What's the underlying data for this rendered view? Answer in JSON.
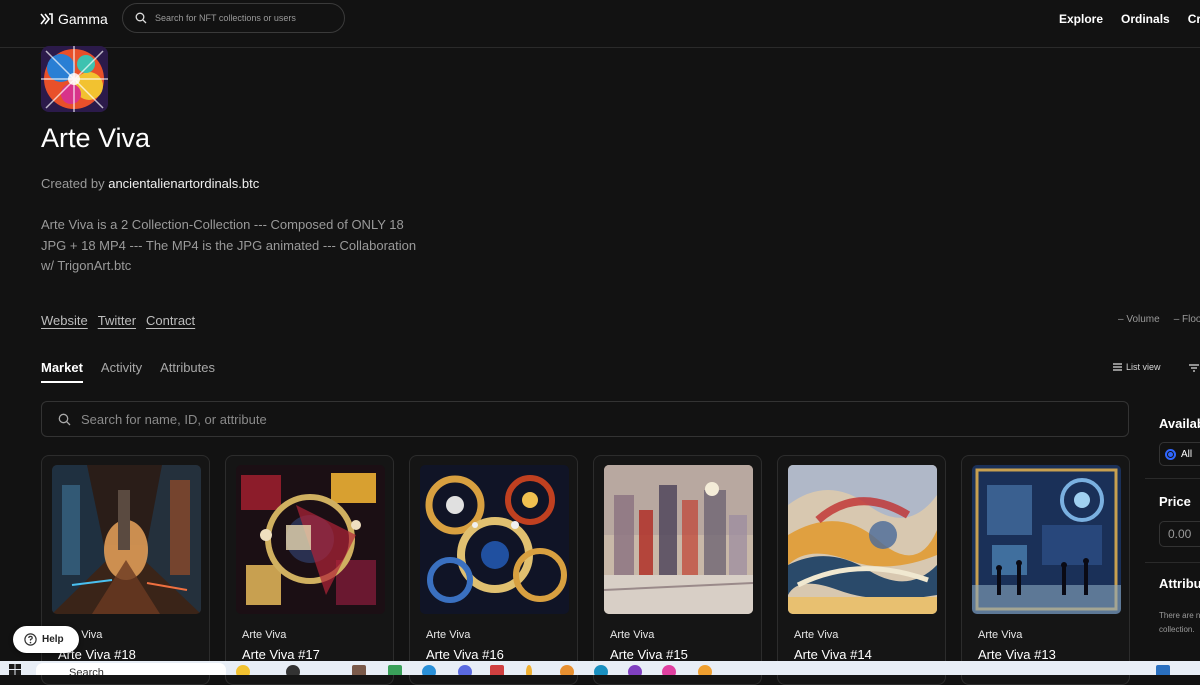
{
  "nav": {
    "logo_text": "Gamma",
    "search_placeholder": "Search for NFT collections or users",
    "links": [
      "Explore",
      "Ordinals",
      "Creat"
    ]
  },
  "collection": {
    "title": "Arte Viva",
    "created_by_label": "Created by",
    "creator": "ancientalienartordinals.btc",
    "description": "Arte Viva is a 2 Collection-Collection --- Composed of ONLY 18 JPG + 18 MP4 --- The MP4 is the JPG animated --- Collaboration w/ TrigonArt.btc",
    "links": [
      "Website",
      "Twitter",
      "Contract"
    ],
    "stats": [
      "– Volume",
      "– Floo"
    ]
  },
  "tabs": [
    "Market",
    "Activity",
    "Attributes"
  ],
  "view_toggle": "List view",
  "main_search_placeholder": "Search for name, ID, or attribute",
  "cards": [
    {
      "collection": "Arte Viva",
      "name": "Arte Viva #18"
    },
    {
      "collection": "Arte Viva",
      "name": "Arte Viva #17"
    },
    {
      "collection": "Arte Viva",
      "name": "Arte Viva #16"
    },
    {
      "collection": "Arte Viva",
      "name": "Arte Viva #15"
    },
    {
      "collection": "Arte Viva",
      "name": "Arte Viva #14"
    },
    {
      "collection": "Arte Viva",
      "name": "Arte Viva #13"
    }
  ],
  "sidebar": {
    "availability_label": "Availab",
    "all_option": "All",
    "price_label": "Price",
    "price_placeholder": "0.00",
    "attributes_label": "Attribu",
    "attributes_note": "There are n collection."
  },
  "help_label": "Help",
  "taskbar": {
    "search_text": "Search"
  },
  "colors": {
    "background": "#121212",
    "accent_radio": "#2f66ff"
  }
}
